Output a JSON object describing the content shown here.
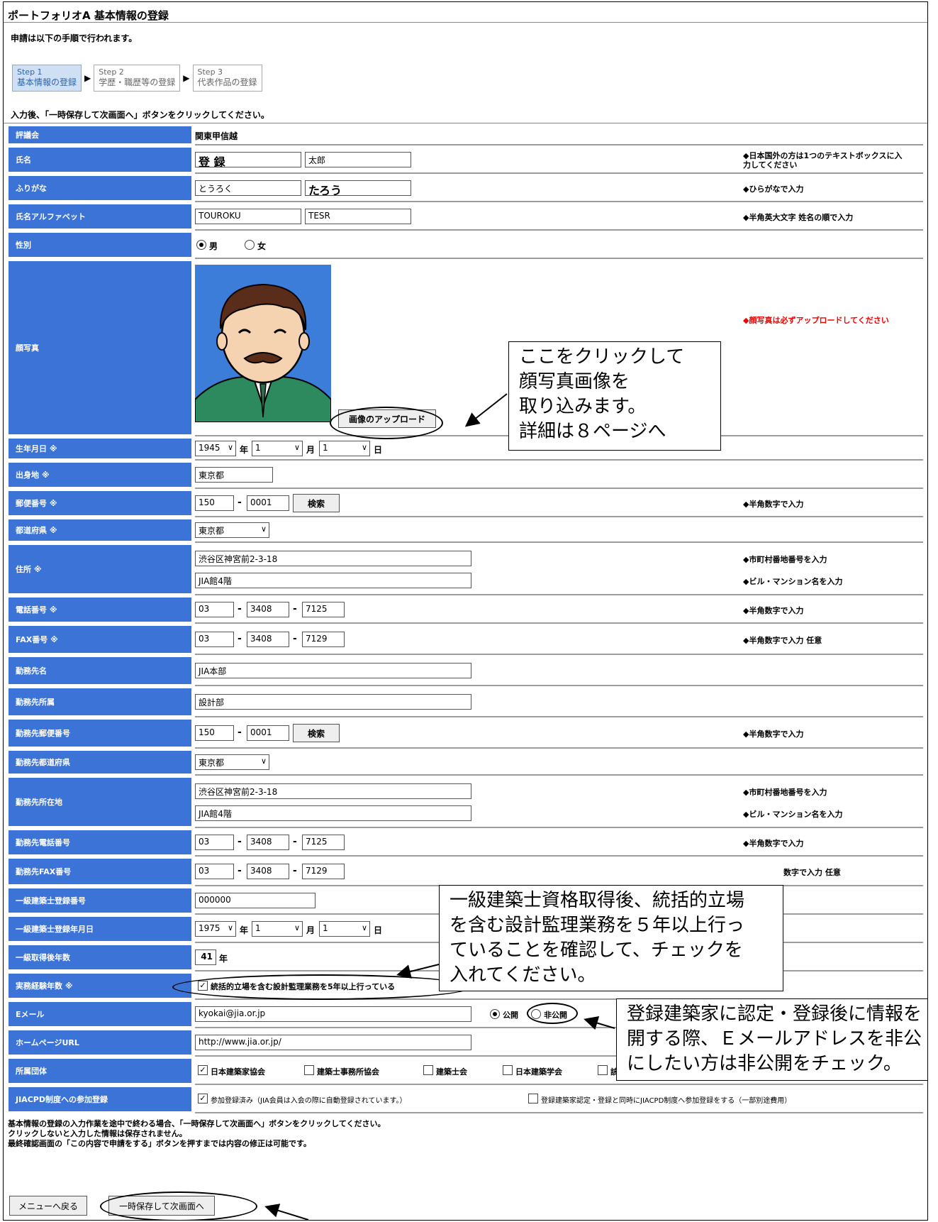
{
  "header": {
    "title": "ポートフォリオA 基本情報の登録",
    "intro": "申請は以下の手順で行われます。",
    "instruction": "入力後、「一時保存して次画面へ」ボタンをクリックしてください。"
  },
  "steps": [
    {
      "num": "Step 1",
      "label": "基本情報の登録"
    },
    {
      "num": "Step 2",
      "label": "学歴・職歴等の登録"
    },
    {
      "num": "Step 3",
      "label": "代表作品の登録"
    }
  ],
  "step_arrow": "▶",
  "labels": {
    "branch": "評議会",
    "name": "氏名",
    "furigana": "ふりがな",
    "alpha": "氏名アルファベット",
    "gender": "性別",
    "photo": "顔写真",
    "birth": "生年月日 ※",
    "birthplace": "出身地 ※",
    "zip": "郵便番号 ※",
    "pref": "都道府県 ※",
    "address": "住所 ※",
    "tel": "電話番号 ※",
    "fax": "FAX番号 ※",
    "company": "勤務先名",
    "dept": "勤務先所属",
    "c_zip": "勤務先郵便番号",
    "c_pref": "勤務先都道府県",
    "c_addr": "勤務先所在地",
    "c_tel": "勤務先電話番号",
    "c_fax": "勤務先FAX番号",
    "kenchiku_no": "一級建築士登録番号",
    "kenchiku_date": "一級建築士登録年月日",
    "kenchiku_years": "一級取得後年数",
    "career_years": "実務経験年数 ※",
    "email": "Eメール",
    "hp": "ホームページURL",
    "org": "所属団体",
    "jiacpd": "JIACPD制度への参加登録"
  },
  "values": {
    "branch": "関東甲信越",
    "last_name": "登 録",
    "first_name": "太郎",
    "furi_last": "とうろく",
    "furi_first": "たろう",
    "alpha_last": "TOUROKU",
    "alpha_first": "TESR",
    "gender_male": "男",
    "gender_female": "女",
    "upload_btn": "画像のアップロード",
    "birth_year": "1945",
    "birth_month": "1",
    "birth_day": "1",
    "year_unit": "年",
    "month_unit": "月",
    "day_unit": "日",
    "birthplace": "東京都",
    "zip1": "150",
    "zip2": "0001",
    "search_btn": "検索",
    "pref": "東京都",
    "addr1": "渋谷区神宮前2-3-18",
    "addr2": "JIA館4階",
    "tel1": "03",
    "tel2": "3408",
    "tel3": "7125",
    "fax1": "03",
    "fax2": "3408",
    "fax3": "7129",
    "company": "JIA本部",
    "dept": "設計部",
    "c_zip1": "150",
    "c_zip2": "0001",
    "c_pref": "東京都",
    "c_addr1": "渋谷区神宮前2-3-18",
    "c_addr2": "JIA館4階",
    "c_tel1": "03",
    "c_tel2": "3408",
    "c_tel3": "7125",
    "c_fax1": "03",
    "c_fax2": "3408",
    "c_fax3": "7129",
    "kenchiku_no": "000000",
    "k_year": "1975",
    "k_month": "1",
    "k_day": "1",
    "k_years": "41",
    "years_unit": "年",
    "career_check": "統括的立場を含む設計監理業務を5年以上行っている",
    "email": "kyokai@jia.or.jp",
    "email_public": "公開",
    "email_private": "非公開",
    "hp": "http://www.jia.or.jp/",
    "org1": "日本建築家協会",
    "org2": "建築士事務所協会",
    "org3": "建築士会",
    "org4": "日本建築学会",
    "org5": "該当なし",
    "jiacpd1": "参加登録済み（JIA会員は入会の際に自動登録されています。）",
    "jiacpd2": "登録建築家認定・登録と同時にJIACPD制度へ参加登録をする（一部別途費用）"
  },
  "hints": {
    "name": "◆日本国外の方は1つのテキストボックスに入力してください",
    "furigana": "◆ひらがなで入力",
    "alpha": "◆半角英大文字 姓名の順で入力",
    "photo": "◆顔写真は必ずアップロードしてください",
    "zip": "◆半角数字で入力",
    "addr1": "◆市町村番地番号を入力",
    "addr2": "◆ビル・マンション名を入力",
    "tel": "◆半角数字で入力",
    "fax": "◆半角数字で入力 任意",
    "c_zip": "◆半角数字で入力",
    "c_addr1": "◆市町村番地番号を入力",
    "c_addr2": "◆ビル・マンション名を入力",
    "c_tel": "◆半角数字で入力",
    "c_fax": "数字で入力 任意"
  },
  "callouts": {
    "photo": [
      "ここをクリックして",
      "顔写真画像を",
      "取り込みます。",
      "詳細は８ページへ"
    ],
    "career": [
      "一級建築士資格取得後、統括的立場",
      "を含む設計監理業務を５年以上行っ",
      "ていることを確認して、チェックを",
      "入れてください。"
    ],
    "email": [
      "登録建築家に認定・登録後に情報を",
      "開する際、Ｅメールアドレスを非公",
      "にしたい方は非公開をチェック。"
    ]
  },
  "footer": {
    "note1": "基本情報の登録の入力作業を途中で終わる場合、「一時保存して次画面へ」ボタンをクリックしてください。",
    "note2": "クリックしないと入力した情報は保存されません。",
    "note3": "最終確認画面の「この内容で申請をする」ボタンを押すまでは内容の修正は可能です。",
    "menu_btn": "メニューへ戻る",
    "save_btn": "一時保存して次画面へ"
  },
  "colors": {
    "label_bg": "#3c73d6",
    "step_active_bg": "#cfe0f5",
    "hint_red": "#ee0000"
  }
}
